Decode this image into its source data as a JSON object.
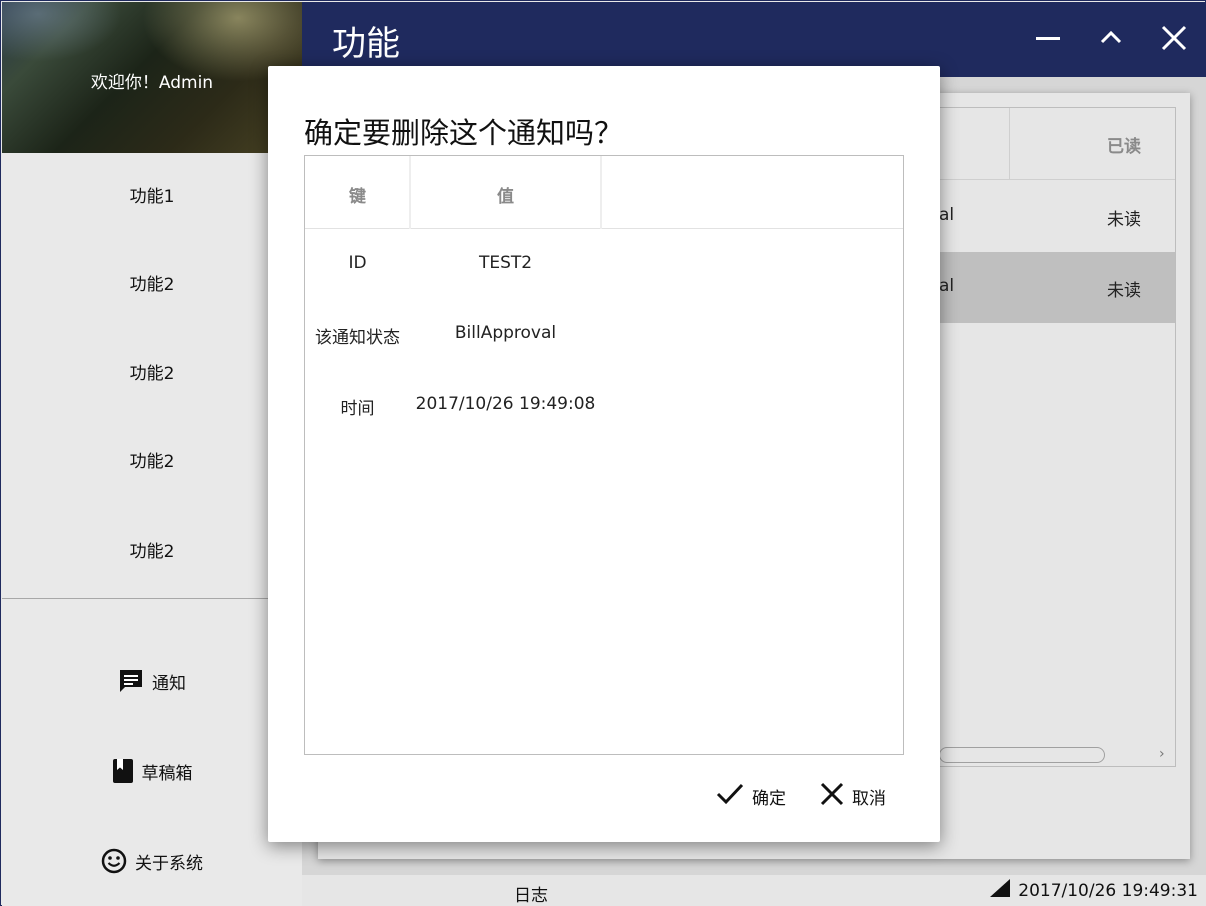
{
  "app": {
    "title": "功能",
    "welcome": "欢迎你！Admin"
  },
  "sidebar": {
    "items": [
      {
        "label": "功能1"
      },
      {
        "label": "功能2"
      },
      {
        "label": "功能2"
      },
      {
        "label": "功能2"
      },
      {
        "label": "功能2"
      }
    ],
    "bottom": [
      {
        "label": "通知",
        "icon": "message-icon"
      },
      {
        "label": "草稿箱",
        "icon": "bookmark-icon"
      },
      {
        "label": "关于系统",
        "icon": "smiley-icon"
      }
    ]
  },
  "window_controls": {
    "minimize": "minimize-icon",
    "maximize": "chevron-up-icon",
    "close": "close-icon"
  },
  "grid": {
    "read_header": "已读",
    "rows": [
      {
        "partial": "al",
        "read": "未读",
        "selected": false
      },
      {
        "partial": "al",
        "read": "未读",
        "selected": true
      }
    ]
  },
  "statusbar": {
    "log_label": "日志",
    "time": "2017/10/26 19:49:31"
  },
  "dialog": {
    "title": "确定要删除这个通知吗？",
    "headers": {
      "key": "键",
      "value": "值"
    },
    "rows": [
      {
        "key": "ID",
        "value": "TEST2"
      },
      {
        "key": "该通知状态",
        "value": "BillApproval"
      },
      {
        "key": "时间",
        "value": "2017/10/26 19:49:08"
      }
    ],
    "confirm_label": "确定",
    "cancel_label": "取消"
  },
  "colors": {
    "titlebar": "#1f2a5e",
    "background": "#e9e9e9",
    "selected_row": "#bfbfbf",
    "dialog": "#ffffff"
  }
}
